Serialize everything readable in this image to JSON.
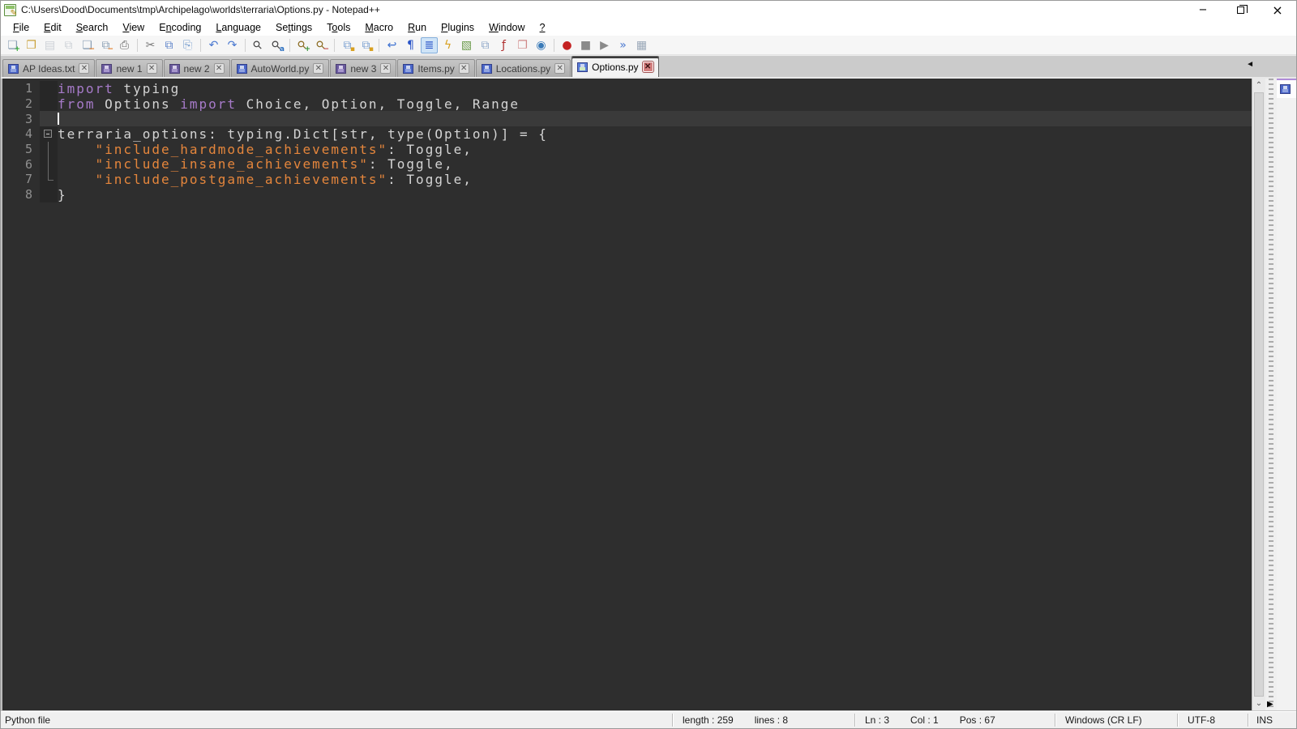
{
  "window": {
    "title": "C:\\Users\\Dood\\Documents\\tmp\\Archipelago\\worlds\\terraria\\Options.py - Notepad++",
    "controls": [
      {
        "name": "minimize-button",
        "icon": "minimize-icon"
      },
      {
        "name": "restore-button",
        "icon": "restore-icon"
      },
      {
        "name": "close-button",
        "icon": "close-icon"
      }
    ]
  },
  "menu": [
    {
      "label": "File",
      "mnemonic": 0
    },
    {
      "label": "Edit",
      "mnemonic": 0
    },
    {
      "label": "Search",
      "mnemonic": 0
    },
    {
      "label": "View",
      "mnemonic": 0
    },
    {
      "label": "Encoding",
      "mnemonic": 1
    },
    {
      "label": "Language",
      "mnemonic": 0
    },
    {
      "label": "Settings",
      "mnemonic": 2
    },
    {
      "label": "Tools",
      "mnemonic": 1
    },
    {
      "label": "Macro",
      "mnemonic": 0
    },
    {
      "label": "Run",
      "mnemonic": 0
    },
    {
      "label": "Plugins",
      "mnemonic": 0
    },
    {
      "label": "Window",
      "mnemonic": 0
    },
    {
      "label": "?",
      "mnemonic": 0
    }
  ],
  "toolbar": {
    "groups": [
      [
        {
          "name": "new-file"
        },
        {
          "name": "open-file"
        },
        {
          "name": "save-file",
          "disabled": true
        },
        {
          "name": "save-all",
          "disabled": true
        },
        {
          "name": "close-file"
        },
        {
          "name": "close-all"
        },
        {
          "name": "print"
        }
      ],
      [
        {
          "name": "cut"
        },
        {
          "name": "copy"
        },
        {
          "name": "paste"
        }
      ],
      [
        {
          "name": "undo"
        },
        {
          "name": "redo"
        }
      ],
      [
        {
          "name": "find"
        },
        {
          "name": "replace"
        }
      ],
      [
        {
          "name": "zoom-in"
        },
        {
          "name": "zoom-out"
        }
      ],
      [
        {
          "name": "sync-vertical-scroll"
        },
        {
          "name": "sync-horizontal-scroll"
        }
      ],
      [
        {
          "name": "word-wrap"
        },
        {
          "name": "show-all-characters"
        },
        {
          "name": "show-indent-guide",
          "active": true
        },
        {
          "name": "user-defined-language"
        },
        {
          "name": "document-map"
        },
        {
          "name": "document-switcher"
        },
        {
          "name": "function-list"
        },
        {
          "name": "folder-as-workspace"
        },
        {
          "name": "monitoring"
        }
      ],
      [
        {
          "name": "macro-record"
        },
        {
          "name": "macro-stop"
        },
        {
          "name": "macro-play"
        },
        {
          "name": "macro-run-multiple"
        },
        {
          "name": "macro-save"
        }
      ]
    ]
  },
  "tabs": [
    {
      "label": "AP Ideas.txt",
      "icon": "saved",
      "active": false
    },
    {
      "label": "new 1",
      "icon": "modified",
      "active": false
    },
    {
      "label": "new 2",
      "icon": "modified",
      "active": false
    },
    {
      "label": "AutoWorld.py",
      "icon": "saved",
      "active": false
    },
    {
      "label": "new 3",
      "icon": "modified",
      "active": false
    },
    {
      "label": "Items.py",
      "icon": "saved",
      "active": false
    },
    {
      "label": "Locations.py",
      "icon": "saved",
      "active": false
    },
    {
      "label": "Options.py",
      "icon": "saved",
      "active": true
    }
  ],
  "editor": {
    "colors": {
      "background": "#2e2e2e",
      "keyword": "#a77bca",
      "string": "#e5863c",
      "plain": "#d4d4d4",
      "line_number": "#909090",
      "current_line": "#3a3a3a"
    },
    "cursor_line": 3,
    "lines": [
      {
        "n": "1",
        "segs": [
          {
            "t": "import",
            "c": "kw"
          },
          {
            "t": " typing",
            "c": "pl"
          }
        ]
      },
      {
        "n": "2",
        "segs": [
          {
            "t": "from",
            "c": "kw"
          },
          {
            "t": " Options ",
            "c": "pl"
          },
          {
            "t": "import",
            "c": "kw"
          },
          {
            "t": " Choice, Option, Toggle, Range",
            "c": "pl"
          }
        ]
      },
      {
        "n": "3",
        "segs": [],
        "current": true,
        "cursor": true
      },
      {
        "n": "4",
        "segs": [
          {
            "t": "terraria_options: typing.Dict[str, type(Option)] = {",
            "c": "pl"
          }
        ],
        "fold": "open"
      },
      {
        "n": "5",
        "segs": [
          {
            "t": "    ",
            "c": "pl"
          },
          {
            "t": "\"include_hardmode_achievements\"",
            "c": "st"
          },
          {
            "t": ": Toggle,",
            "c": "pl"
          }
        ],
        "fold": "guide"
      },
      {
        "n": "6",
        "segs": [
          {
            "t": "    ",
            "c": "pl"
          },
          {
            "t": "\"include_insane_achievements\"",
            "c": "st"
          },
          {
            "t": ": Toggle,",
            "c": "pl"
          }
        ],
        "fold": "guide"
      },
      {
        "n": "7",
        "segs": [
          {
            "t": "    ",
            "c": "pl"
          },
          {
            "t": "\"include_postgame_achievements\"",
            "c": "st"
          },
          {
            "t": ": Toggle,",
            "c": "pl"
          }
        ],
        "fold": "corner"
      },
      {
        "n": "8",
        "segs": [
          {
            "t": "}",
            "c": "pl"
          }
        ]
      }
    ]
  },
  "status": {
    "doc_type": "Python file",
    "length": "length : 259",
    "lines": "lines : 8",
    "ln": "Ln : 3",
    "col": "Col : 1",
    "pos": "Pos : 67",
    "eol": "Windows (CR LF)",
    "encoding": "UTF-8",
    "insert_mode": "INS"
  }
}
